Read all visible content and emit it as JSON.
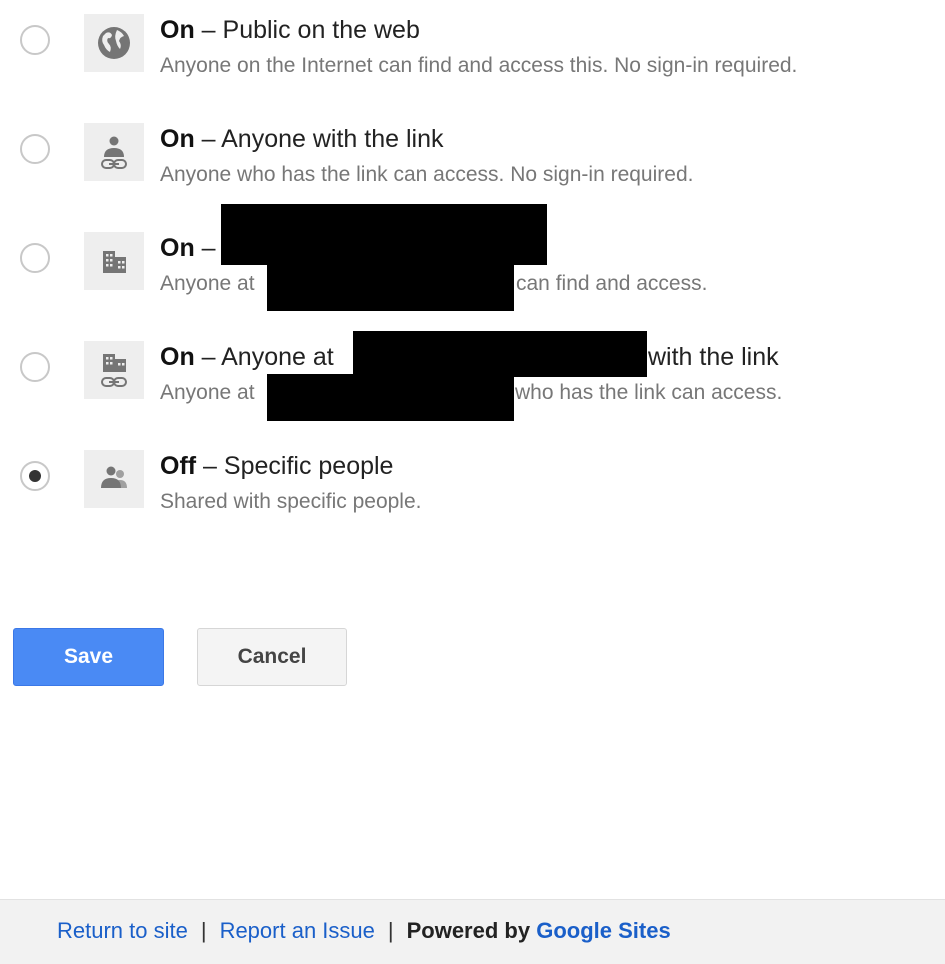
{
  "options": [
    {
      "state": "On",
      "title": " – Public on the web",
      "description": "Anyone on the Internet can find and access this. No sign-in required.",
      "icon": "globe-icon",
      "selected": false
    },
    {
      "state": "On",
      "title": " – Anyone with the link",
      "description": "Anyone who has the link can access. No sign-in required.",
      "icon": "person-link-icon",
      "selected": false
    },
    {
      "state": "On",
      "title": " –",
      "description_before": "Anyone at",
      "description_after": "can find and access.",
      "icon": "building-icon",
      "selected": false
    },
    {
      "state": "On",
      "title_before": " – Anyone at",
      "title_after": "with the link",
      "description_before": "Anyone at",
      "description_after": "who has the link can access.",
      "icon": "building-link-icon",
      "selected": false
    },
    {
      "state": "Off",
      "title": " – Specific people",
      "description": "Shared with specific people.",
      "icon": "people-icon",
      "selected": true
    }
  ],
  "buttons": {
    "save": "Save",
    "cancel": "Cancel"
  },
  "footer": {
    "return_link": "Return to site",
    "separator": "|",
    "report_link": "Report an Issue",
    "powered_by": "Powered by",
    "google_sites": "Google Sites"
  },
  "colors": {
    "save_button": "#4a8af4",
    "link": "#1a5fc9",
    "icon": "#757575"
  }
}
